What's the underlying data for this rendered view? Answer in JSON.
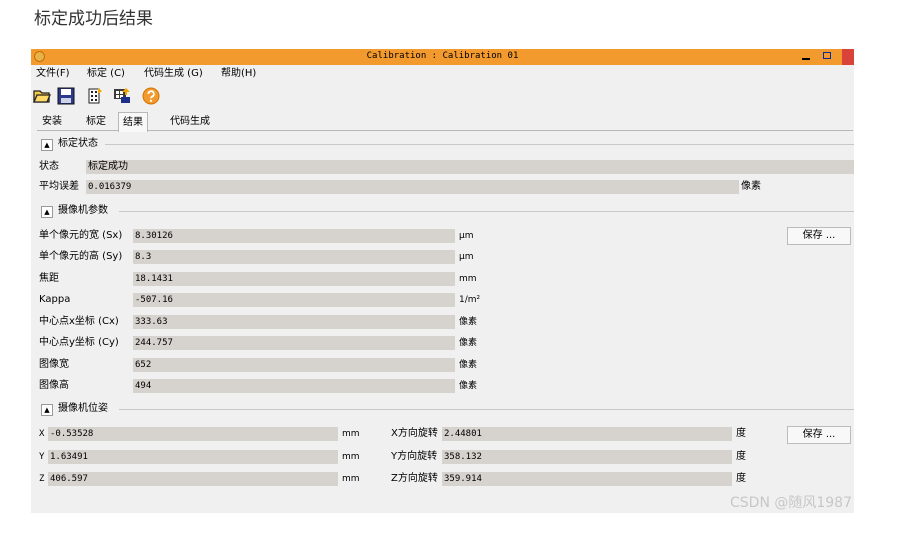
{
  "caption": "标定成功后结果",
  "window": {
    "title": "Calibration : Calibration 01"
  },
  "menu": [
    "文件(F)",
    "标定 (C)",
    "代码生成 (G)",
    "帮助(H)"
  ],
  "toolbar_icons": [
    "open-folder-icon",
    "save-disk-icon",
    "calibration-plate-icon",
    "camera-grab-icon",
    "help-icon"
  ],
  "tabs": [
    "安装",
    "标定",
    "结果",
    "代码生成"
  ],
  "active_tab": "结果",
  "status_section": {
    "title": "标定状态",
    "state_label": "状态",
    "state_value": "标定成功",
    "error_label": "平均误差",
    "error_value": "0.016379",
    "error_unit": "像素"
  },
  "camera_params": {
    "title": "摄像机参数",
    "save_label": "保存 ...",
    "rows": [
      {
        "label": "单个像元的宽 (Sx)",
        "value": "8.30126",
        "unit": "μm"
      },
      {
        "label": "单个像元的高 (Sy)",
        "value": "8.3",
        "unit": "μm"
      },
      {
        "label": "焦距",
        "value": "18.1431",
        "unit": "mm"
      },
      {
        "label": "Kappa",
        "value": "-507.16",
        "unit": "1/m²"
      },
      {
        "label": "中心点x坐标 (Cx)",
        "value": "333.63",
        "unit": "像素"
      },
      {
        "label": "中心点y坐标 (Cy)",
        "value": "244.757",
        "unit": "像素"
      },
      {
        "label": "图像宽",
        "value": "652",
        "unit": "像素"
      },
      {
        "label": "图像高",
        "value": "494",
        "unit": "像素"
      }
    ]
  },
  "camera_pose": {
    "title": "摄像机位姿",
    "save_label": "保存 ...",
    "rows": [
      {
        "label": "X",
        "value": "-0.53528",
        "unit": "mm",
        "rot_label": "X方向旋转",
        "rot_value": "2.44801",
        "rot_unit": "度"
      },
      {
        "label": "Y",
        "value": "1.63491",
        "unit": "mm",
        "rot_label": "Y方向旋转",
        "rot_value": "358.132",
        "rot_unit": "度"
      },
      {
        "label": "Z",
        "value": "406.597",
        "unit": "mm",
        "rot_label": "Z方向旋转",
        "rot_value": "359.914",
        "rot_unit": "度"
      }
    ]
  },
  "watermark": "CSDN @随风1987",
  "colors": {
    "titlebar": "#f39a2e",
    "field": "#d6d2ce",
    "close": "#d9433a"
  }
}
